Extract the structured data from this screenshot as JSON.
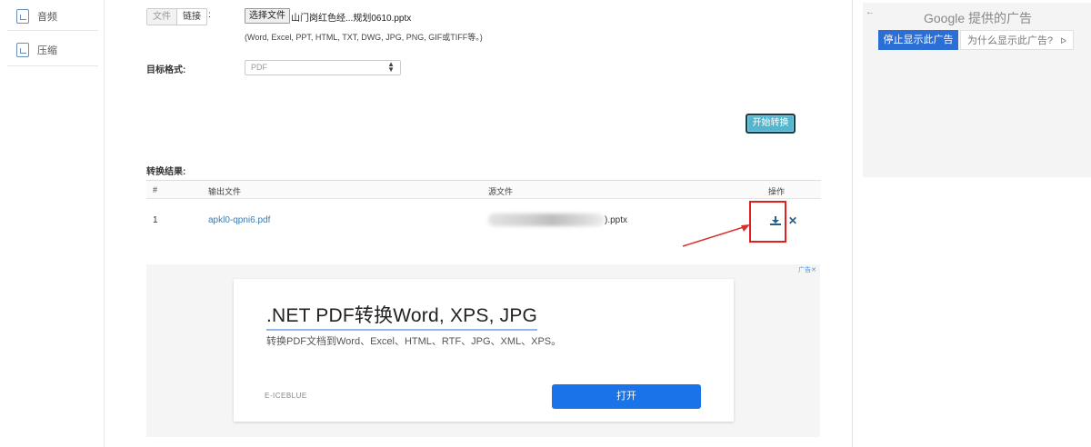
{
  "sidebar": {
    "items": [
      {
        "label": "音频",
        "icon": "audio-file-icon"
      },
      {
        "label": "压缩",
        "icon": "compress-file-icon"
      }
    ]
  },
  "upload": {
    "tab_file": "文件",
    "tab_link": "链接",
    "colon": ":",
    "choose_button": "选择文件",
    "file_name": "山门岗红色经...规划0610.pptx",
    "formats_hint": "(Word, Excel, PPT, HTML, TXT, DWG, JPG, PNG, GIF或TIFF等。)"
  },
  "target": {
    "label": "目标格式:",
    "selected": "PDF"
  },
  "convert_button": "开始转换",
  "results": {
    "label": "转换结果:",
    "columns": [
      "#",
      "输出文件",
      "源文件",
      "操作"
    ],
    "rows": [
      {
        "index": "1",
        "output": "apkl0-qpni6.pdf",
        "source_suffix": ").pptx"
      }
    ]
  },
  "ad": {
    "badge": "广告✕",
    "title": ".NET PDF转换Word, XPS, JPG",
    "description": "转换PDF文档到Word、Excel、HTML、RTF、JPG、XML、XPS。",
    "brand": "E-ICEBLUE",
    "button": "打开"
  },
  "google_ad": {
    "back": "←",
    "title_brand": "Google",
    "title_suffix": "提供的广告",
    "stop_button": "停止显示此广告",
    "why_button": "为什么显示此广告?",
    "why_icon": "ᐅ"
  },
  "colors": {
    "accent": "#52b6cf",
    "link": "#3a7bb0",
    "highlight": "#e02020",
    "ad_button": "#1a73e8"
  }
}
